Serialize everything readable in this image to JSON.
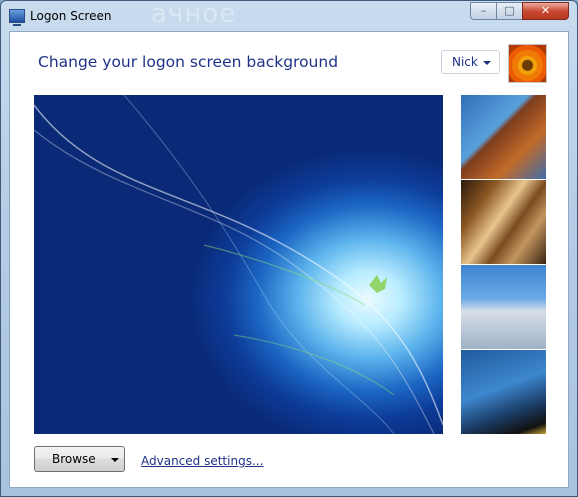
{
  "window": {
    "title": "Logon Screen",
    "background_ghost_text": "ачное",
    "controls": {
      "minimize": "–",
      "maximize": "□",
      "close": "✕"
    }
  },
  "header": {
    "heading": "Change your logon screen background",
    "user_dropdown": {
      "selected": "Nick",
      "icon": "chevron-down-icon"
    },
    "avatar": {
      "description_icon": "flower-avatar"
    }
  },
  "backgrounds": {
    "main_preview": "windows-7-default-background",
    "thumbnails": [
      "architecture-tower",
      "curved-metal-sculpture",
      "white-curved-building",
      "blue-building-overhang"
    ]
  },
  "footer": {
    "browse_label": "Browse",
    "advanced_link": "Advanced settings..."
  },
  "colors": {
    "heading": "#1e3287",
    "link": "#1e3287",
    "window_frame": "#b6cde6",
    "close_button": "#c8452f"
  }
}
